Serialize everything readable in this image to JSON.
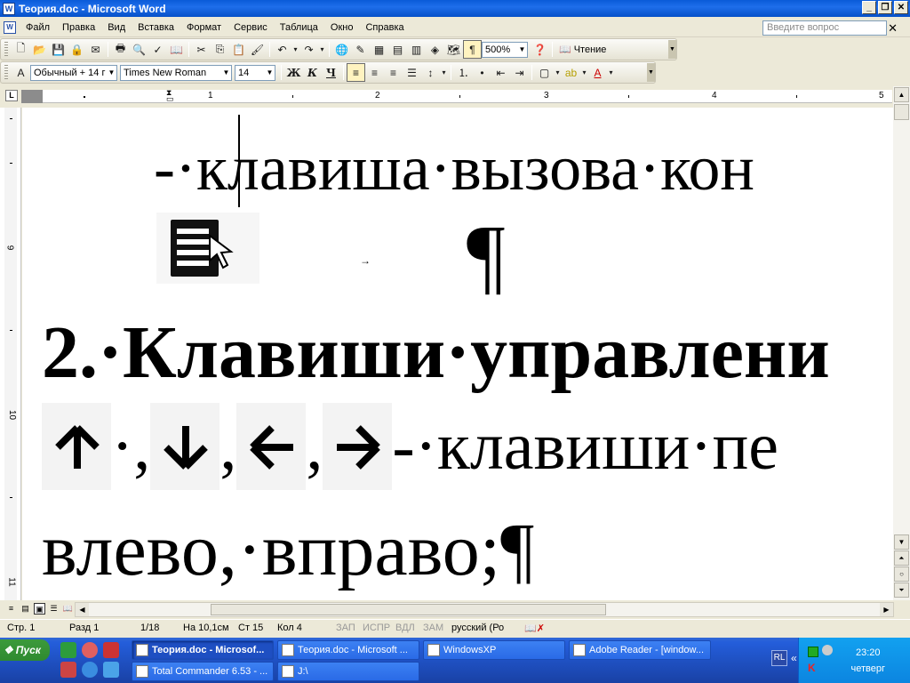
{
  "window": {
    "title": "Теория.doc - Microsoft Word"
  },
  "menu": {
    "items": [
      "Файл",
      "Правка",
      "Вид",
      "Вставка",
      "Формат",
      "Сервис",
      "Таблица",
      "Окно",
      "Справка"
    ],
    "help_placeholder": "Введите вопрос"
  },
  "toolbar_standard": {
    "zoom": "500%",
    "read_label": "Чтение"
  },
  "toolbar_formatting": {
    "style": "Обычный + 14 г",
    "font": "Times New Roman",
    "size": "14",
    "bold_label": "Ж",
    "italic_label": "К",
    "underline_label": "Ч"
  },
  "ruler": {
    "numbers": [
      "1",
      "1",
      "2",
      "3",
      "4",
      "5"
    ],
    "v_numbers": [
      "9",
      "10",
      "11"
    ]
  },
  "document": {
    "line1": "-·клавиша·вызова·кон",
    "pilcrow": "¶",
    "heading": "2.·Клавиши·управлени",
    "arrow_separator": "·, ",
    "comma": ", ",
    "arrow_line_tail": "-·клавиши·пе",
    "line4": "влево,·вправо;¶"
  },
  "status_bar": {
    "page": "Стр. 1",
    "section": "Разд 1",
    "pages": "1/18",
    "at": "На 10,1см",
    "line": "Ст 15",
    "column": "Кол 4",
    "rec": "ЗАП",
    "trk": "ИСПР",
    "ext": "ВДЛ",
    "ovr": "ЗАМ",
    "language": "русский (Ро"
  },
  "taskbar": {
    "start_label": "Пуск",
    "tasks": [
      "Теория.doc - Microsof...",
      "Теория.doc - Microsoft ...",
      "WindowsXP",
      "Adobe Reader - [window...",
      "Total Commander 6.53 - ...",
      "J:\\"
    ],
    "lang": "RL",
    "clock_time": "23:20",
    "clock_day": "четверг"
  }
}
